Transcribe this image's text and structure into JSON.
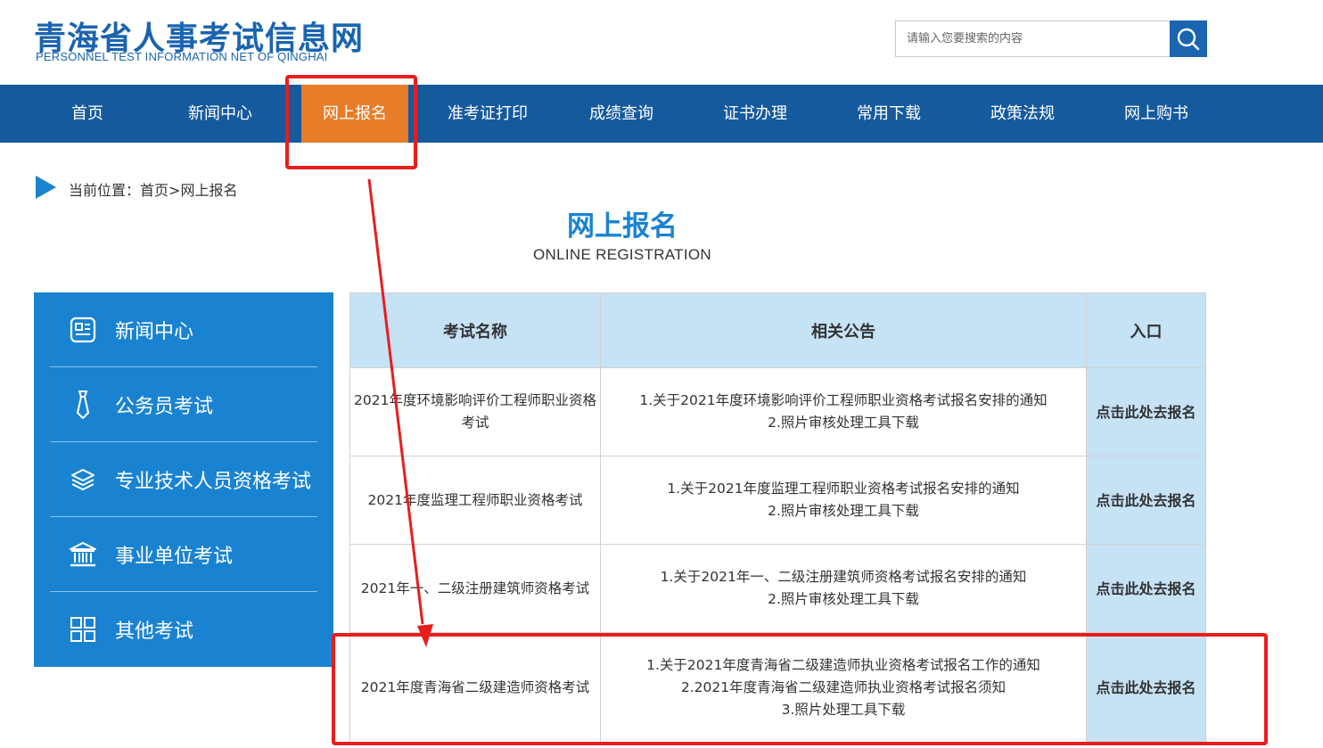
{
  "header": {
    "title": "青海省人事考试信息网",
    "subtitle": "PERSONNEL TEST INFORMATION NET OF QINGHAI",
    "search_placeholder": "请输入您要搜索的内容",
    "search_icon": "search-icon"
  },
  "nav": {
    "items": [
      {
        "label": "首页"
      },
      {
        "label": "新闻中心"
      },
      {
        "label": "网上报名",
        "active": true
      },
      {
        "label": "准考证打印"
      },
      {
        "label": "成绩查询"
      },
      {
        "label": "证书办理"
      },
      {
        "label": "常用下载"
      },
      {
        "label": "政策法规"
      },
      {
        "label": "网上购书"
      }
    ],
    "bg_color": "#165a9e",
    "active_color": "#e77d28"
  },
  "breadcrumb": {
    "prefix": "当前位置：",
    "home": "首页",
    "sep": ">",
    "current": "网上报名"
  },
  "page": {
    "title": "网上报名",
    "subtitle": "ONLINE REGISTRATION"
  },
  "sidebar": {
    "items": [
      {
        "label": "新闻中心",
        "icon": "news-icon"
      },
      {
        "label": "公务员考试",
        "icon": "tie-icon"
      },
      {
        "label": "专业技术人员资格考试",
        "icon": "layers-icon"
      },
      {
        "label": "事业单位考试",
        "icon": "institution-icon"
      },
      {
        "label": "其他考试",
        "icon": "grid-icon"
      }
    ],
    "bg_color": "#1a83d1"
  },
  "table": {
    "headers": [
      "考试名称",
      "相关公告",
      "入口"
    ],
    "rows": [
      {
        "name": "2021年度环境影响评价工程师职业资格考试",
        "notices": [
          "1.关于2021年度环境影响评价工程师职业资格考试报名安排的通知",
          "2.照片审核处理工具下载"
        ],
        "entry": "点击此处去报名"
      },
      {
        "name": "2021年度监理工程师职业资格考试",
        "notices": [
          "1.关于2021年度监理工程师职业资格考试报名安排的通知",
          "2.照片审核处理工具下载"
        ],
        "entry": "点击此处去报名"
      },
      {
        "name": "2021年一、二级注册建筑师资格考试",
        "notices": [
          "1.关于2021年一、二级注册建筑师资格考试报名安排的通知",
          "2.照片审核处理工具下载"
        ],
        "entry": "点击此处去报名"
      },
      {
        "name": "2021年度青海省二级建造师资格考试",
        "notices": [
          "1.关于2021年度青海省二级建造师执业资格考试报名工作的通知",
          "2.2021年度青海省二级建造师执业资格考试报名须知",
          "3.照片处理工具下载"
        ],
        "entry": "点击此处去报名"
      }
    ],
    "header_bg": "#c6e2f5"
  },
  "annotations": {
    "color": "#e81d1d"
  }
}
